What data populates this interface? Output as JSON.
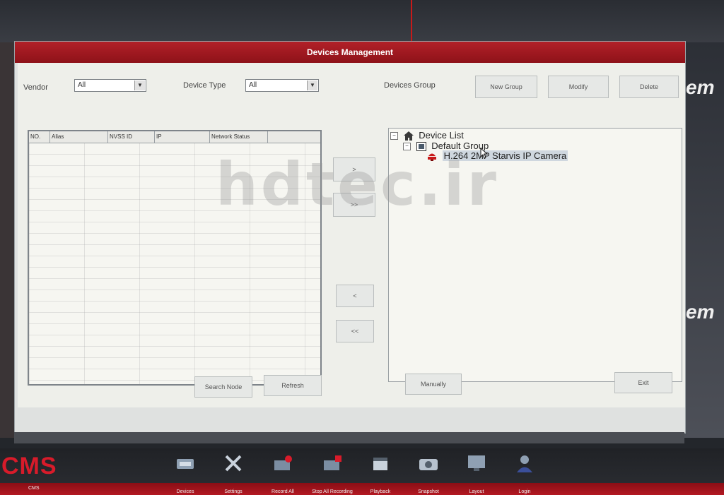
{
  "window": {
    "title": "Devices Management"
  },
  "filters": {
    "vendor_label": "Vendor",
    "vendor_value": "All",
    "device_type_label": "Device Type",
    "device_type_value": "All",
    "devices_group_label": "Devices Group"
  },
  "group_buttons": {
    "new_group": "New Group",
    "modify": "Modify",
    "delete": "Delete"
  },
  "table": {
    "columns": [
      "NO.",
      "Alias",
      "NVSS ID",
      "IP",
      "Network Status"
    ]
  },
  "transfer_buttons": [
    ">",
    ">>",
    "<",
    "<<"
  ],
  "tree": {
    "root": "Device List",
    "group": "Default Group",
    "device": "H.264 2MP Starvis IP Camera"
  },
  "actions": {
    "search_node": "Search Node",
    "refresh": "Refresh",
    "manually": "Manually",
    "exit": "Exit"
  },
  "taskbar": {
    "logo": "CMS",
    "logo_label": "CMS",
    "items": [
      "Devices",
      "Settings",
      "Record All",
      "Stop All Recording",
      "Playback",
      "Snapshot",
      "Layout",
      "Login"
    ]
  },
  "watermark": "hdtec.ir",
  "colors": {
    "title_red": "#a5182a",
    "logo_red": "#d81b2a",
    "panel": "#eeefea"
  },
  "icons": [
    "home-icon",
    "group-icon",
    "camera-icon",
    "dropdown-arrow-icon",
    "pointer-cursor-icon"
  ]
}
